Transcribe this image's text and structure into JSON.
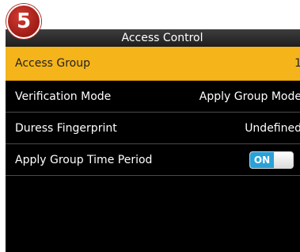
{
  "step_badge": "5",
  "header": {
    "title": "Access Control"
  },
  "menu": {
    "items": [
      {
        "label": "Access Group",
        "value": "1",
        "selected": true
      },
      {
        "label": "Verification Mode",
        "value": "Apply Group Mode"
      },
      {
        "label": "Duress Fingerprint",
        "value": "Undefined"
      },
      {
        "label": "Apply Group Time Period",
        "toggle": "ON"
      }
    ]
  },
  "colors": {
    "selected_row": "#f4b41a",
    "screen_background": "#000000",
    "toggle_on": "#2aa1d8",
    "badge": "#b02a22"
  }
}
